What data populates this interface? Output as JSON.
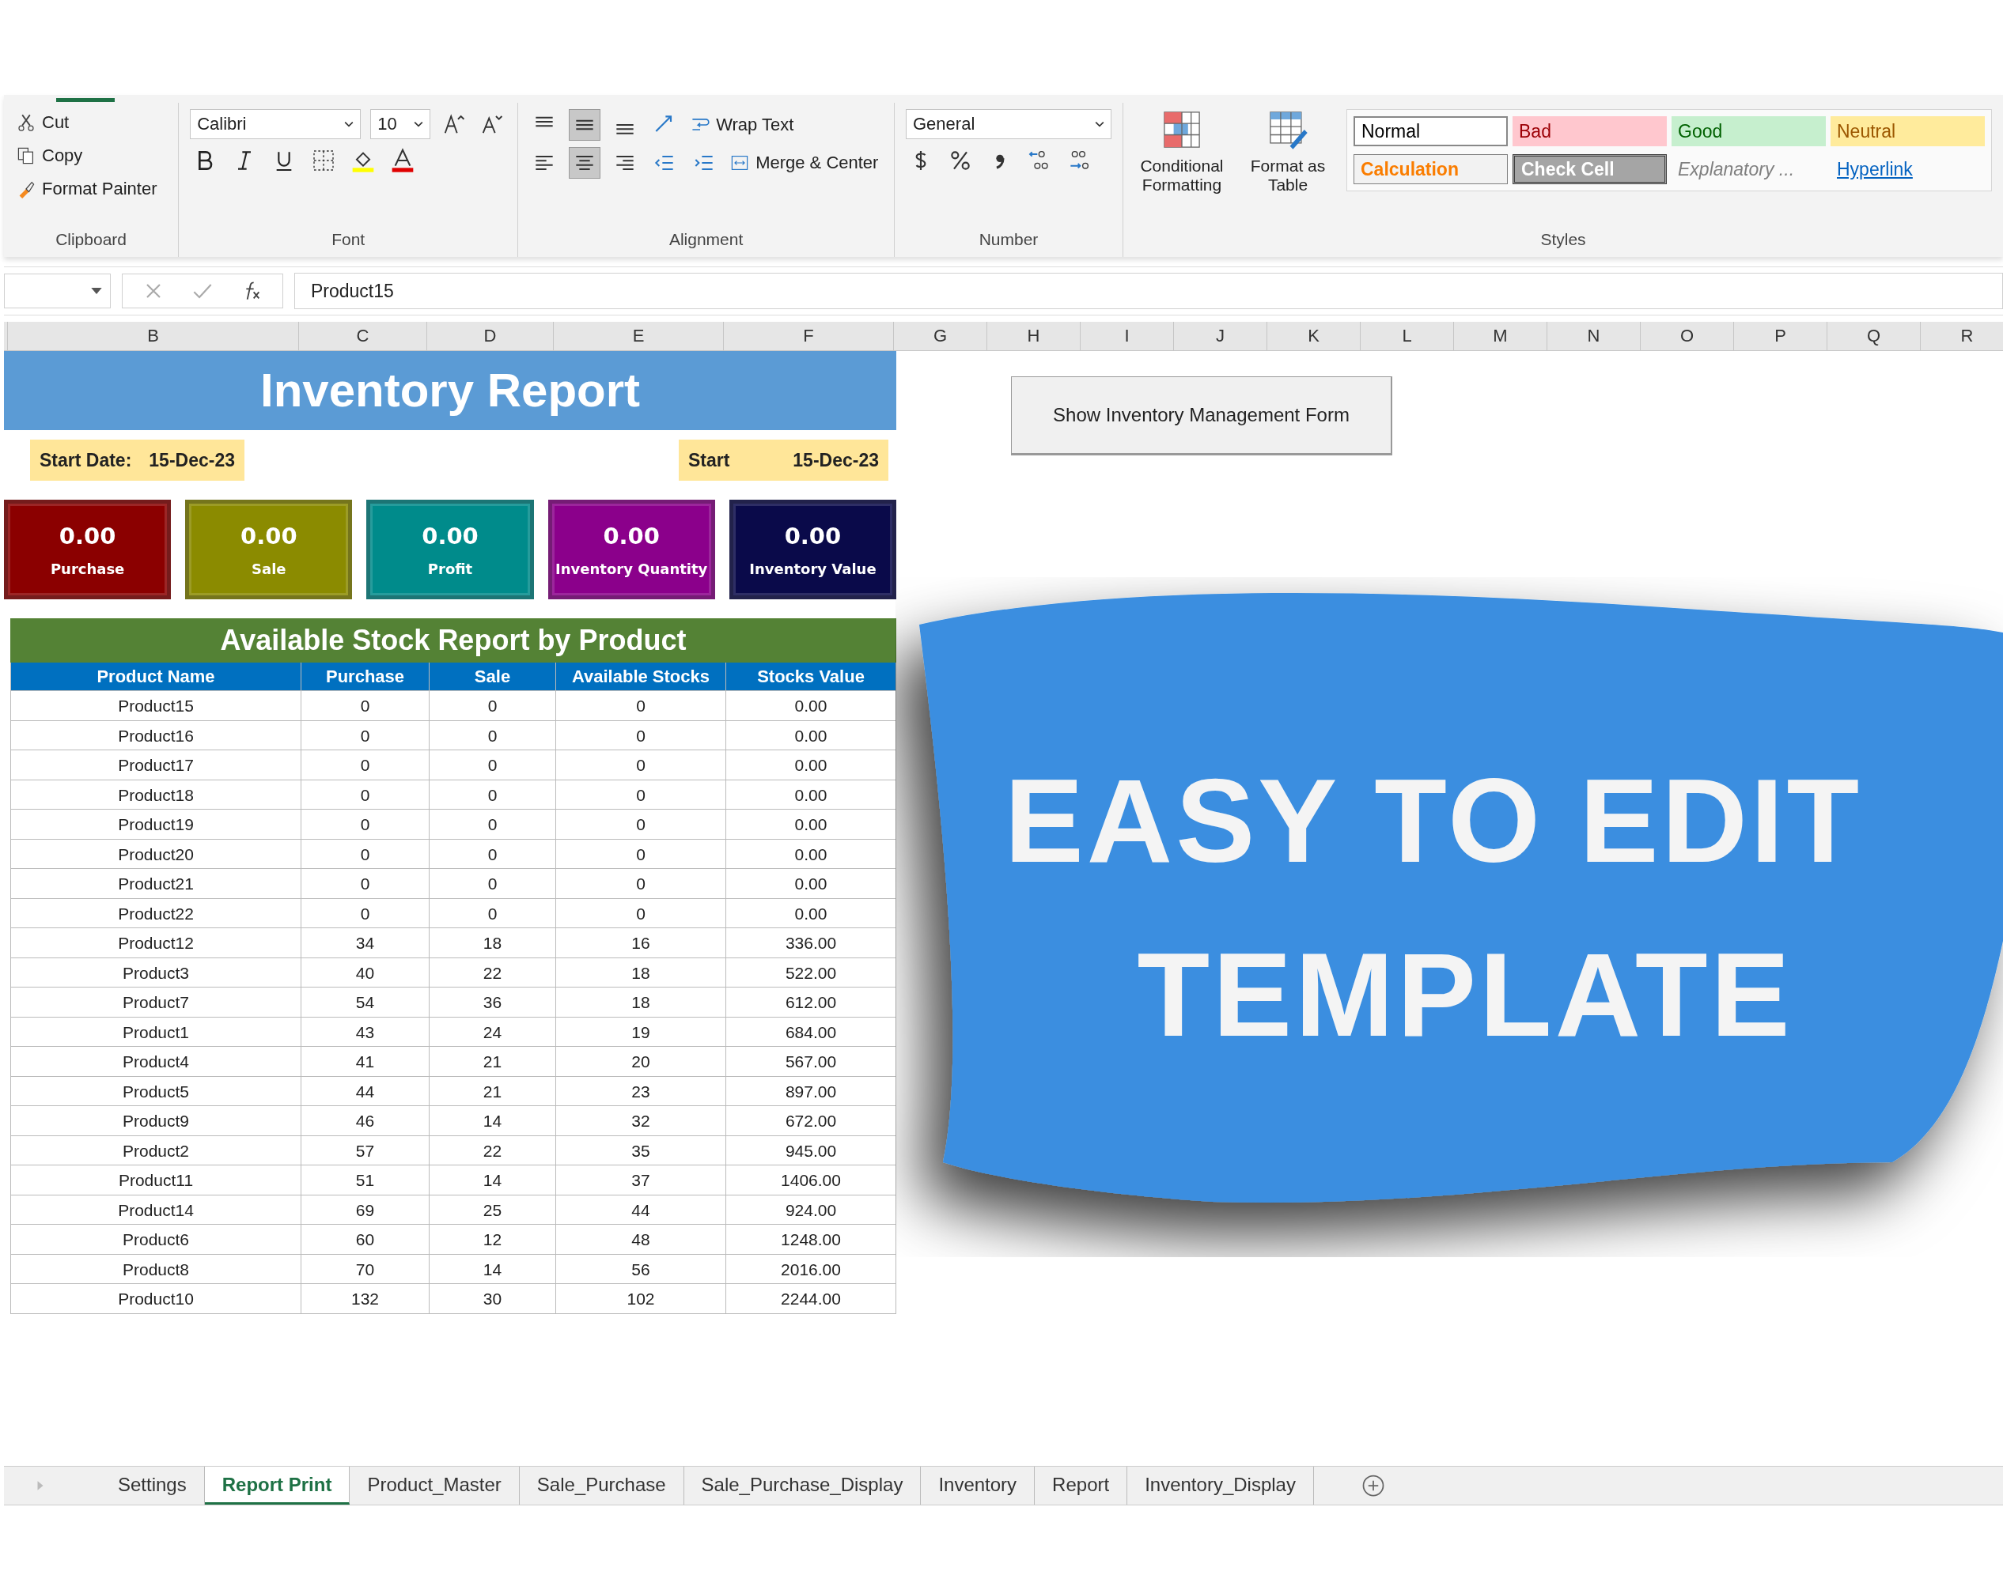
{
  "ribbon": {
    "clipboard": {
      "label": "Clipboard",
      "cut": "Cut",
      "copy": "Copy",
      "format_painter": "Format Painter"
    },
    "font": {
      "label": "Font",
      "font_name": "Calibri",
      "font_size": "10"
    },
    "alignment": {
      "label": "Alignment",
      "wrap_text": "Wrap Text",
      "merge_center": "Merge & Center"
    },
    "number": {
      "label": "Number",
      "format": "General"
    },
    "styles": {
      "label": "Styles",
      "conditional_formatting": "Conditional Formatting",
      "format_as_table": "Format as Table",
      "cells": [
        {
          "label": "Normal",
          "kind": "normal"
        },
        {
          "label": "Bad",
          "kind": "bad"
        },
        {
          "label": "Good",
          "kind": "good"
        },
        {
          "label": "Neutral",
          "kind": "neutral"
        },
        {
          "label": "Calculation",
          "kind": "calculation"
        },
        {
          "label": "Check Cell",
          "kind": "check"
        },
        {
          "label": "Explanatory ...",
          "kind": "explanatory"
        },
        {
          "label": "Hyperlink",
          "kind": "hyperlink"
        }
      ]
    }
  },
  "formula_bar": {
    "value": "Product15"
  },
  "columns": [
    "B",
    "C",
    "D",
    "E",
    "F",
    "G",
    "H",
    "I",
    "J",
    "K",
    "L",
    "M",
    "N",
    "O",
    "P",
    "Q",
    "R"
  ],
  "report": {
    "title": "Inventory Report",
    "start_date": {
      "label": "Start Date:",
      "value": "15-Dec-23"
    },
    "start": {
      "label": "Start",
      "value": "15-Dec-23"
    },
    "cards": [
      {
        "value": "0.00",
        "label": "Purchase",
        "color": "#8b0000"
      },
      {
        "value": "0.00",
        "label": "Sale",
        "color": "#8b8b00"
      },
      {
        "value": "0.00",
        "label": "Profit",
        "color": "#008b8b"
      },
      {
        "value": "0.00",
        "label": "Inventory Quantity",
        "color": "#8b008b"
      },
      {
        "value": "0.00",
        "label": "Inventory Value",
        "color": "#0a0a4a"
      }
    ],
    "table": {
      "title": "Available Stock Report by Product",
      "columns": [
        "Product Name",
        "Purchase",
        "Sale",
        "Available Stocks",
        "Stocks Value"
      ],
      "rows": [
        [
          "Product15",
          "0",
          "0",
          "0",
          "0.00"
        ],
        [
          "Product16",
          "0",
          "0",
          "0",
          "0.00"
        ],
        [
          "Product17",
          "0",
          "0",
          "0",
          "0.00"
        ],
        [
          "Product18",
          "0",
          "0",
          "0",
          "0.00"
        ],
        [
          "Product19",
          "0",
          "0",
          "0",
          "0.00"
        ],
        [
          "Product20",
          "0",
          "0",
          "0",
          "0.00"
        ],
        [
          "Product21",
          "0",
          "0",
          "0",
          "0.00"
        ],
        [
          "Product22",
          "0",
          "0",
          "0",
          "0.00"
        ],
        [
          "Product12",
          "34",
          "18",
          "16",
          "336.00"
        ],
        [
          "Product3",
          "40",
          "22",
          "18",
          "522.00"
        ],
        [
          "Product7",
          "54",
          "36",
          "18",
          "612.00"
        ],
        [
          "Product1",
          "43",
          "24",
          "19",
          "684.00"
        ],
        [
          "Product4",
          "41",
          "21",
          "20",
          "567.00"
        ],
        [
          "Product5",
          "44",
          "21",
          "23",
          "897.00"
        ],
        [
          "Product9",
          "46",
          "14",
          "32",
          "672.00"
        ],
        [
          "Product2",
          "57",
          "22",
          "35",
          "945.00"
        ],
        [
          "Product11",
          "51",
          "14",
          "37",
          "1406.00"
        ],
        [
          "Product14",
          "69",
          "25",
          "44",
          "924.00"
        ],
        [
          "Product6",
          "60",
          "12",
          "48",
          "1248.00"
        ],
        [
          "Product8",
          "70",
          "14",
          "56",
          "2016.00"
        ],
        [
          "Product10",
          "132",
          "30",
          "102",
          "2244.00"
        ]
      ]
    }
  },
  "form_button": "Show Inventory Management Form",
  "banner": {
    "lines": [
      "EASY TO EDIT",
      "TEMPLATE"
    ]
  },
  "sheet_tabs": [
    {
      "label": "Settings",
      "selected": false
    },
    {
      "label": "Report Print",
      "selected": true
    },
    {
      "label": "Product_Master",
      "selected": false
    },
    {
      "label": "Sale_Purchase",
      "selected": false
    },
    {
      "label": "Sale_Purchase_Display",
      "selected": false
    },
    {
      "label": "Inventory",
      "selected": false
    },
    {
      "label": "Report",
      "selected": false
    },
    {
      "label": "Inventory_Display",
      "selected": false
    }
  ]
}
